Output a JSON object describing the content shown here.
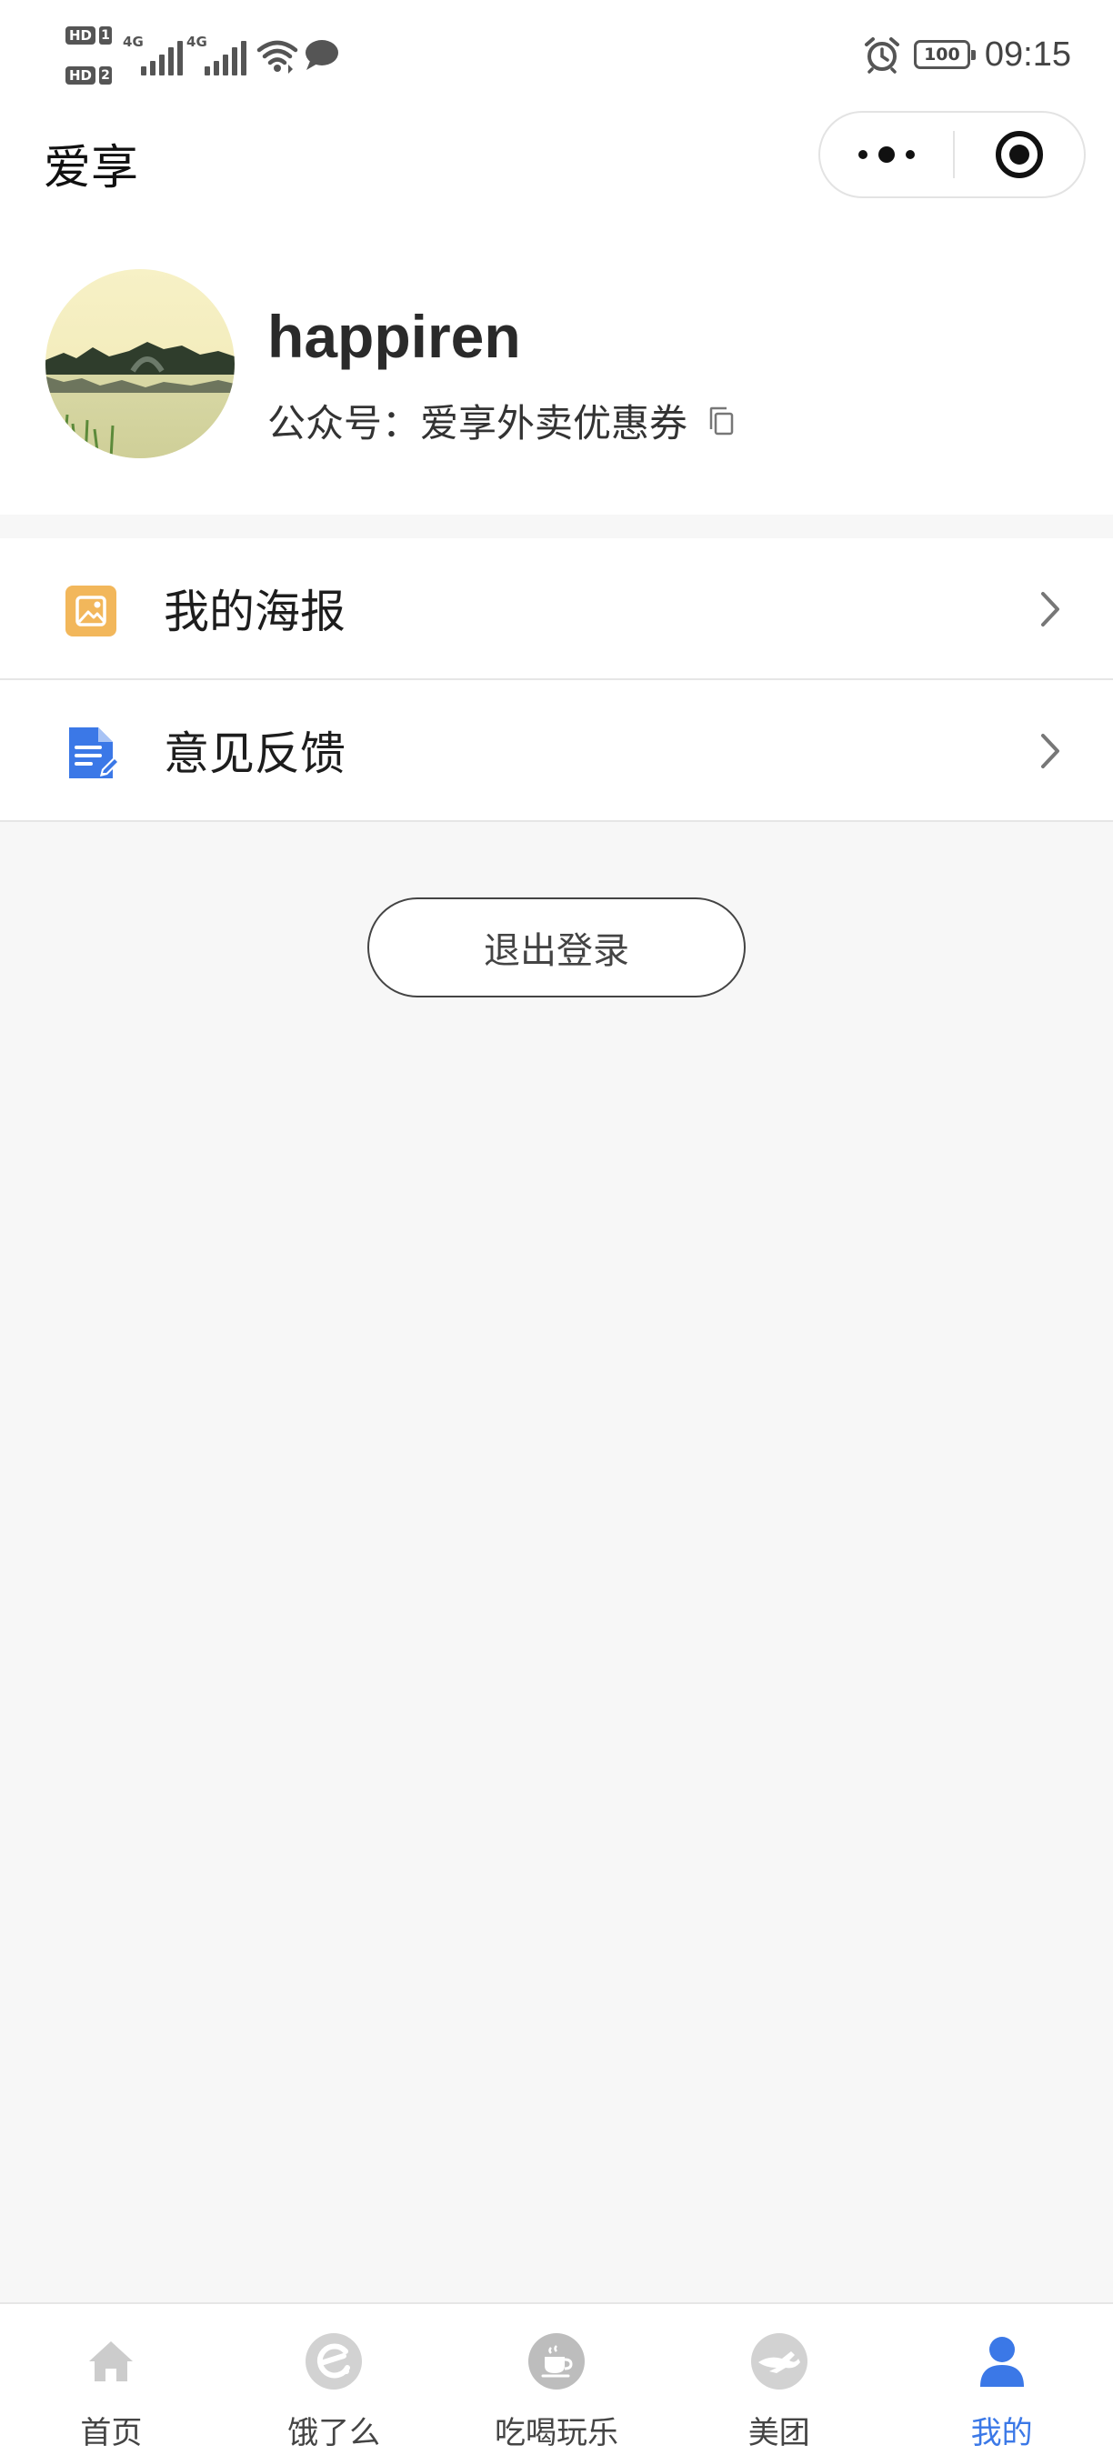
{
  "status_bar": {
    "sim1_badge": "HD",
    "sim1_slot": "1",
    "sim2_badge": "HD",
    "sim2_slot": "2",
    "network1": "4G",
    "network2": "4G",
    "battery": "100",
    "time": "09:15",
    "icons": [
      "signal-icon",
      "wifi-icon",
      "message-icon",
      "alarm-icon",
      "battery-icon"
    ]
  },
  "title_bar": {
    "title": "爱享",
    "icons": [
      "more-icon",
      "close-target-icon"
    ]
  },
  "profile": {
    "username": "happiren",
    "account_label": "公众号：",
    "account_name": "爱享外卖优惠券",
    "icons": [
      "avatar",
      "copy-icon"
    ]
  },
  "menu": {
    "items": [
      {
        "label": "我的海报",
        "icon": "poster-image-icon",
        "icon_color": "#f2b75b"
      },
      {
        "label": "意见反馈",
        "icon": "feedback-document-icon",
        "icon_color": "#3b78e7"
      }
    ]
  },
  "logout": {
    "label": "退出登录"
  },
  "tab_bar": {
    "active_color": "#3b78e7",
    "inactive_color": "#cccccc",
    "tabs": [
      {
        "label": "首页",
        "icon": "home-icon",
        "active": false
      },
      {
        "label": "饿了么",
        "icon": "eleme-icon",
        "active": false
      },
      {
        "label": "吃喝玩乐",
        "icon": "coffee-cup-icon",
        "active": false
      },
      {
        "label": "美团",
        "icon": "kangaroo-icon",
        "active": false
      },
      {
        "label": "我的",
        "icon": "user-icon",
        "active": true
      }
    ]
  }
}
